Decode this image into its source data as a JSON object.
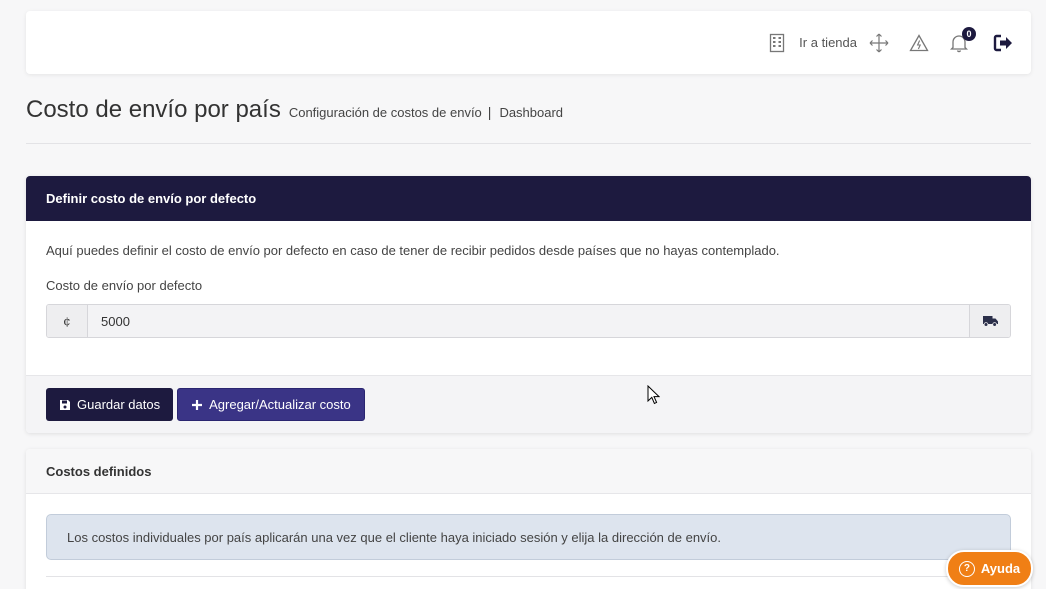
{
  "topbar": {
    "store_link_label": "Ir a tienda",
    "notifications_count": "0"
  },
  "header": {
    "title": "Costo de envío por país",
    "subtitle": "Configuración de costos de envío",
    "separator": "|",
    "breadcrumb": "Dashboard"
  },
  "default_cost_card": {
    "title": "Definir costo de envío por defecto",
    "description": "Aquí puedes definir el costo de envío por defecto en caso de tener de recibir pedidos desde países que no hayas contemplado.",
    "field_label": "Costo de envío por defecto",
    "currency_symbol": "¢",
    "value": "5000",
    "save_button": "Guardar datos",
    "add_button": "Agregar/Actualizar costo"
  },
  "defined_costs_card": {
    "title": "Costos definidos",
    "info_message": "Los costos individuales por país aplicarán una vez que el cliente haya iniciado sesión y elija la dirección de envío."
  },
  "help_button": {
    "label": "Ayuda",
    "icon_glyph": "?"
  },
  "colors": {
    "primary_dark": "#1d1a3f",
    "accent_purple": "#3a3486",
    "help_orange": "#f07f15",
    "alert_bg": "#dde4ee"
  },
  "icons": [
    "building-icon",
    "expand-arrows-icon",
    "warning-icon",
    "bell-icon",
    "logout-icon",
    "truck-icon",
    "save-icon",
    "plus-icon",
    "question-circle-icon"
  ]
}
